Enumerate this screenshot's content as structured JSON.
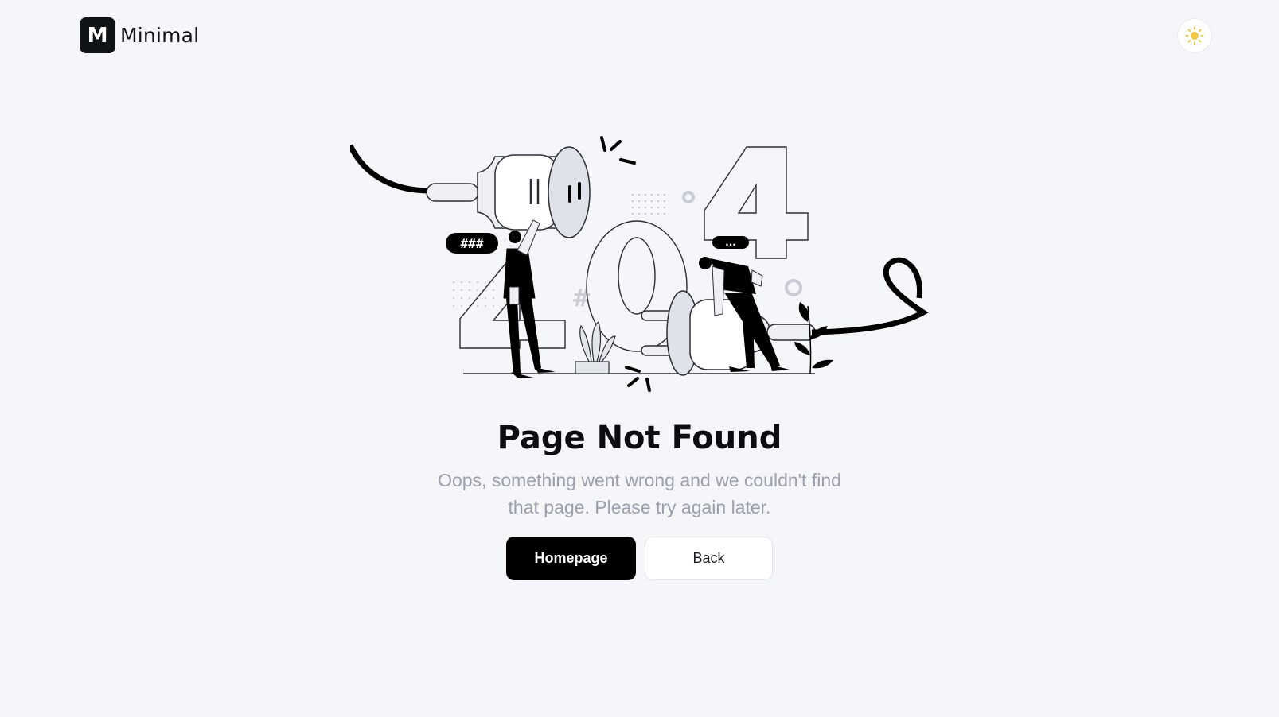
{
  "header": {
    "logo_letter": "M",
    "logo_text": "Minimal"
  },
  "theme_toggle": {
    "icon": "sun-icon",
    "color": "#f5c542"
  },
  "illustration": {
    "bubble_left": "###",
    "bubble_right": "...",
    "hash_sign": "#",
    "digits": [
      "4",
      "0",
      "4"
    ]
  },
  "content": {
    "title": "Page Not Found",
    "message": "Oops, something went wrong and we couldn't find that page. Please try again later."
  },
  "actions": {
    "primary_label": "Homepage",
    "secondary_label": "Back"
  }
}
